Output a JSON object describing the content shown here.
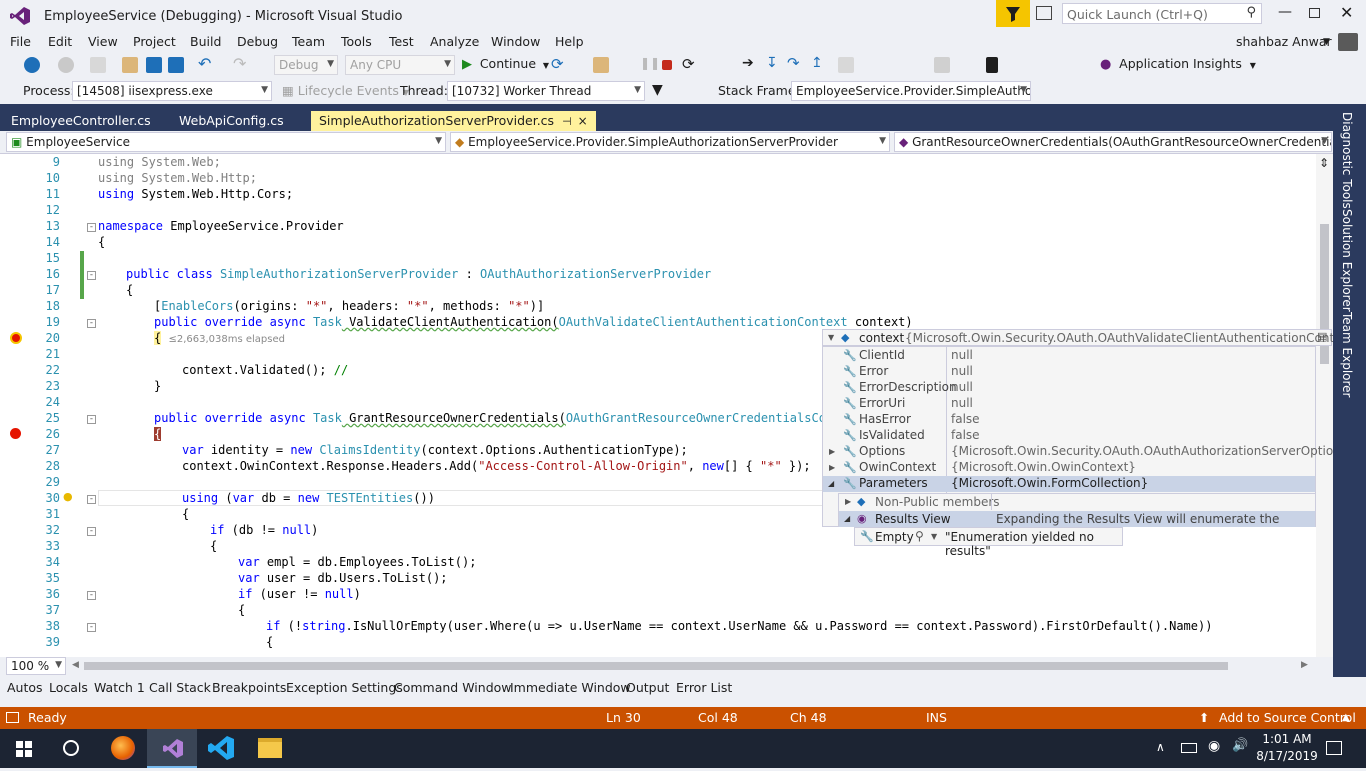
{
  "window": {
    "title": "EmployeeService (Debugging) - Microsoft Visual Studio",
    "quick_launch_placeholder": "Quick Launch (Ctrl+Q)",
    "user": "shahbaz Anwar"
  },
  "menu": [
    "File",
    "Edit",
    "View",
    "Project",
    "Build",
    "Debug",
    "Team",
    "Tools",
    "Test",
    "Analyze",
    "Window",
    "Help"
  ],
  "toolbar": {
    "config": "Debug",
    "platform": "Any CPU",
    "continue_label": "Continue",
    "app_insights": "Application Insights"
  },
  "debugbar": {
    "process_label": "Process:",
    "process_value": "[14508] iisexpress.exe",
    "lifecycle": "Lifecycle Events",
    "thread_label": "Thread:",
    "thread_value": "[10732] Worker Thread",
    "stackframe_label": "Stack Frame:",
    "stackframe_value": "EmployeeService.Provider.SimpleAuthoriz"
  },
  "tabs": [
    {
      "label": "EmployeeController.cs"
    },
    {
      "label": "WebApiConfig.cs"
    },
    {
      "label": "SimpleAuthorizationServerProvider.cs",
      "pin": "⊣",
      "close": "×"
    }
  ],
  "nav": {
    "project": "EmployeeService",
    "class": "EmployeeService.Provider.SimpleAuthorizationServerProvider",
    "member": "GrantResourceOwnerCredentials(OAuthGrantResourceOwnerCredentialsCon"
  },
  "lines": [
    "9",
    "10",
    "11",
    "12",
    "13",
    "14",
    "15",
    "16",
    "17",
    "18",
    "19",
    "20",
    "21",
    "22",
    "23",
    "24",
    "25",
    "26",
    "27",
    "28",
    "29",
    "30",
    "31",
    "32",
    "33",
    "34",
    "35",
    "36",
    "37",
    "38",
    "39"
  ],
  "code": {
    "l9a": "using",
    "l9b": " System.Web;",
    "l10a": "using",
    "l10b": " System.Web.Http;",
    "l11a": "using",
    "l11b": " System.Web.Http.Cors;",
    "l13a": "namespace",
    "l13b": " EmployeeService.Provider",
    "l14": "{",
    "l16a": "public class",
    "l16b": "SimpleAuthorizationServerProvider",
    "l16c": " : ",
    "l16d": "OAuthAuthorizationServerProvider",
    "l17": "{",
    "l18a": "[",
    "l18b": "EnableCors",
    "l18c": "(origins: ",
    "l18d": "\"*\"",
    "l18e": ", headers: ",
    "l18f": "\"*\"",
    "l18g": ", methods: ",
    "l18h": "\"*\"",
    "l18i": ")]",
    "l19a": "public override async",
    "l19b": "Task",
    "l19c": " ValidateClientAuthentication(",
    "l19d": "OAuthValidateClientAuthenticationContext",
    "l19e": " context)",
    "l20a": "{",
    "l20b": "≤2,663,038ms elapsed",
    "l22a": "context.Validated(); ",
    "l22b": "//",
    "l23": "}",
    "l25a": "public override async",
    "l25b": "Task",
    "l25c": " GrantResourceOwnerCredentials(",
    "l25d": "OAuthGrantResourceOwnerCredentialsConte",
    "l26": "{",
    "l27a": "var",
    "l27b": " identity = ",
    "l27c": "new",
    "l27d": "ClaimsIdentity",
    "l27e": "(context.Options.AuthenticationType);",
    "l28a": "context.OwinContext.Response.Headers.Add(",
    "l28b": "\"Access-Control-Allow-Origin\"",
    "l28c": ", ",
    "l28d": "new",
    "l28e": "[] { ",
    "l28f": "\"*\"",
    "l28g": " });",
    "l30a": "using",
    "l30b": " (",
    "l30c": "var",
    "l30d": " db = ",
    "l30e": "new",
    "l30f": "TESTEntities",
    "l30g": "())",
    "l31": "{",
    "l32a": "if",
    "l32b": " (db != ",
    "l32c": "null",
    "l32d": ")",
    "l33": "{",
    "l34a": "var",
    "l34b": " empl = db.Employees.ToList();",
    "l35a": "var",
    "l35b": " user = db.Users.ToList();",
    "l36a": "if",
    "l36b": " (user != ",
    "l36c": "null",
    "l36d": ")",
    "l37": "{",
    "l38a": "if",
    "l38b": " (!",
    "l38c": "string",
    "l38d": ".IsNullOrEmpty(user.Where(u => u.UserName == context.UserName && u.Password == context.Password).FirstOrDefault().Name))",
    "l39": "{"
  },
  "datatip": {
    "header_name": "context",
    "header_value": "{Microsoft.Owin.Security.OAuth.OAuthValidateClientAuthenticationContext}",
    "rows": [
      {
        "name": "ClientId",
        "value": "null"
      },
      {
        "name": "Error",
        "value": "null"
      },
      {
        "name": "ErrorDescription",
        "value": "null"
      },
      {
        "name": "ErrorUri",
        "value": "null"
      },
      {
        "name": "HasError",
        "value": "false"
      },
      {
        "name": "IsValidated",
        "value": "false"
      },
      {
        "name": "Options",
        "value": "{Microsoft.Owin.Security.OAuth.OAuthAuthorizationServerOptions}"
      },
      {
        "name": "OwinContext",
        "value": "{Microsoft.Owin.OwinContext}"
      },
      {
        "name": "Parameters",
        "value": "{Microsoft.Owin.FormCollection}"
      }
    ],
    "nonpublic": "Non-Public members",
    "resultsview": "Results View",
    "resultsview_value": "Expanding the Results View will enumerate the IEnumerable",
    "empty_name": "Empty",
    "empty_value": "\"Enumeration yielded no results\""
  },
  "zoom": "100 %",
  "right_tabs": [
    "Diagnostic Tools",
    "Solution Explorer",
    "Team Explorer"
  ],
  "toolwindows": [
    "Autos",
    "Locals",
    "Watch 1",
    "Call Stack",
    "Breakpoints",
    "Exception Settings",
    "Command Window",
    "Immediate Window",
    "Output",
    "Error List"
  ],
  "status": {
    "ready": "Ready",
    "ln": "Ln 30",
    "col": "Col 48",
    "ch": "Ch 48",
    "ins": "INS",
    "source_control": "Add to Source Control"
  },
  "clock": {
    "time": "1:01 AM",
    "date": "8/17/2019"
  },
  "colors": {
    "status_bar": "#ca5100",
    "tab_strip": "#2b3a5e",
    "active_tab": "#fff29d",
    "breakpoint": "#e51400"
  }
}
